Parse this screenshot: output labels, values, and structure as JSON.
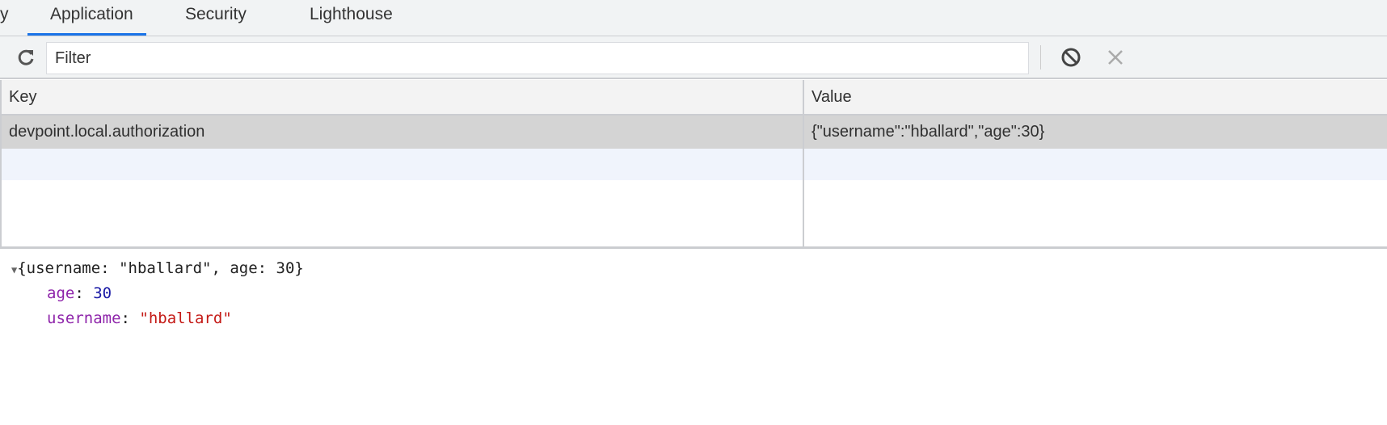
{
  "tabs": [
    {
      "label": "y"
    },
    {
      "label": "Application",
      "active": true
    },
    {
      "label": "Security"
    },
    {
      "label": "Lighthouse"
    }
  ],
  "toolbar": {
    "refresh_icon": "refresh-icon",
    "filter_placeholder": "Filter",
    "filter_value": "",
    "clear_all_icon": "block-icon",
    "delete_icon": "close-icon"
  },
  "table": {
    "headers": [
      "Key",
      "Value"
    ],
    "rows": [
      {
        "key": "devpoint.local.authorization",
        "value": "{\"username\":\"hballard\",\"age\":30}",
        "selected": true
      }
    ]
  },
  "preview": {
    "summary": "{username: \"hballard\", age: 30}",
    "props": [
      {
        "key": "age",
        "sep": ": ",
        "value": "30"
      },
      {
        "key": "username",
        "sep": ": ",
        "value": "\"hballard\""
      }
    ]
  },
  "colors": {
    "accent": "#1a73e8",
    "selected_row": "#d4d4d4",
    "number": "#1a1aa6",
    "string": "#c41a16",
    "property": "#8e24aa"
  }
}
